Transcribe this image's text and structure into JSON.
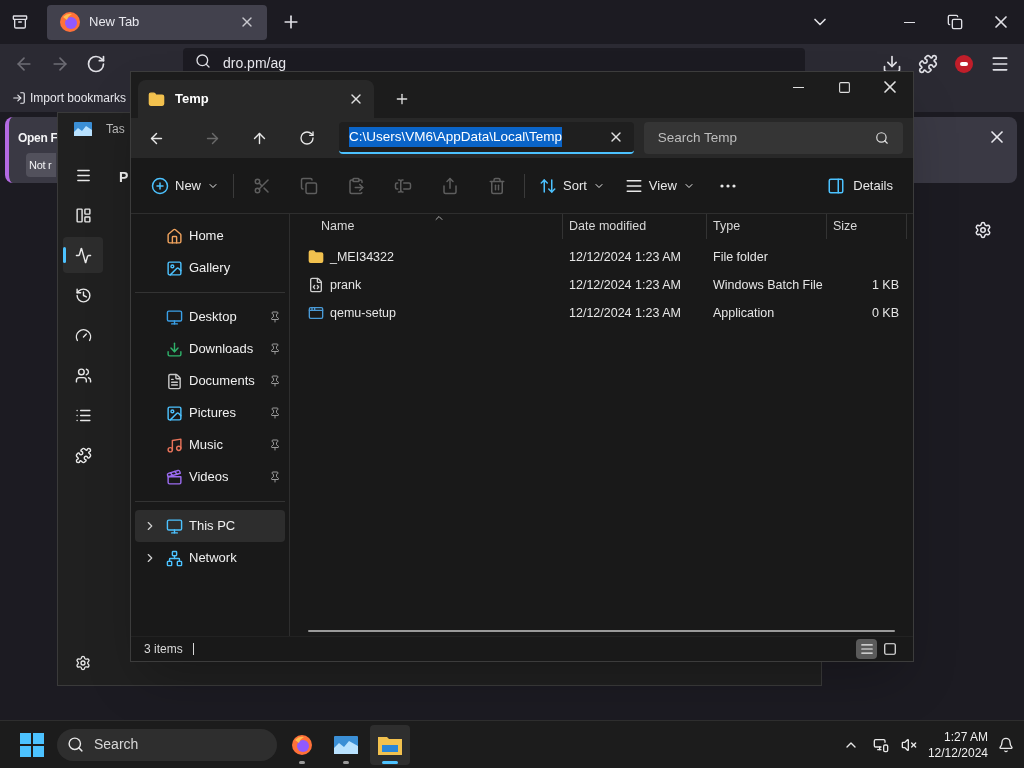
{
  "browser": {
    "tab": {
      "title": "New Tab",
      "selected": true
    },
    "url": "dro.pm/ag",
    "bookmarks": [
      {
        "label": "Import bookmarks"
      }
    ],
    "notification": {
      "title": "Open F",
      "button": "Not r"
    }
  },
  "task_manager": {
    "title": "Tas",
    "heading": "P",
    "rail": [
      {
        "kind": "menu",
        "selected": false
      },
      {
        "kind": "processes",
        "selected": false
      },
      {
        "kind": "performance",
        "selected": true
      },
      {
        "kind": "history",
        "selected": false
      },
      {
        "kind": "startup",
        "selected": false
      },
      {
        "kind": "users",
        "selected": false
      },
      {
        "kind": "details",
        "selected": false
      },
      {
        "kind": "services",
        "selected": false
      }
    ]
  },
  "explorer": {
    "tab": {
      "title": "Temp"
    },
    "address": "C:\\Users\\VM6\\AppData\\Local\\Temp",
    "search": {
      "placeholder": "Search Temp"
    },
    "toolbar": [
      {
        "kind": "new",
        "label": "New",
        "disabled": false
      },
      {
        "kind": "cut",
        "disabled": true
      },
      {
        "kind": "copy",
        "disabled": true
      },
      {
        "kind": "paste",
        "disabled": true
      },
      {
        "kind": "rename",
        "disabled": true
      },
      {
        "kind": "share",
        "disabled": true
      },
      {
        "kind": "delete",
        "disabled": true
      },
      {
        "kind": "sort",
        "label": "Sort",
        "disabled": false
      },
      {
        "kind": "view",
        "label": "View",
        "disabled": false
      },
      {
        "kind": "more",
        "disabled": false
      }
    ],
    "details_button": "Details",
    "nav_groups": [
      [
        {
          "kind": "home",
          "label": "Home",
          "pinned": false,
          "selected": false
        },
        {
          "kind": "gallery",
          "label": "Gallery",
          "pinned": false,
          "selected": false
        }
      ],
      [
        {
          "kind": "desktop",
          "label": "Desktop",
          "pinned": true,
          "selected": false
        },
        {
          "kind": "downloads",
          "label": "Downloads",
          "pinned": true,
          "selected": false
        },
        {
          "kind": "documents",
          "label": "Documents",
          "pinned": true,
          "selected": false
        },
        {
          "kind": "pictures",
          "label": "Pictures",
          "pinned": true,
          "selected": false
        },
        {
          "kind": "music",
          "label": "Music",
          "pinned": true,
          "selected": false
        },
        {
          "kind": "videos",
          "label": "Videos",
          "pinned": true,
          "selected": false
        }
      ],
      [
        {
          "kind": "pc",
          "label": "This PC",
          "pinned": false,
          "selected": true,
          "expanded": false
        },
        {
          "kind": "network",
          "label": "Network",
          "pinned": false,
          "selected": false,
          "expanded": false
        }
      ]
    ],
    "columns": [
      "Name",
      "Date modified",
      "Type",
      "Size"
    ],
    "rows": [
      {
        "kind": "folder",
        "name": "_MEI34322",
        "date": "12/12/2024 1:23 AM",
        "type": "File folder"
      },
      {
        "kind": "batch",
        "name": "prank",
        "date": "12/12/2024 1:23 AM",
        "type": "Windows Batch File",
        "size": "1 KB"
      },
      {
        "kind": "app",
        "name": "qemu-setup",
        "date": "12/12/2024 1:23 AM",
        "type": "Application",
        "size": "0 KB"
      }
    ],
    "status": "3 items",
    "views": [
      {
        "kind": "details",
        "selected": true
      },
      {
        "kind": "tiles",
        "selected": false
      }
    ]
  },
  "taskbar": {
    "search": "Search",
    "apps": [
      {
        "kind": "firefox",
        "selected": false
      },
      {
        "kind": "taskmanager",
        "selected": false
      },
      {
        "kind": "explorer",
        "selected": true
      }
    ],
    "time": "1:27 AM",
    "date": "12/12/2024"
  }
}
